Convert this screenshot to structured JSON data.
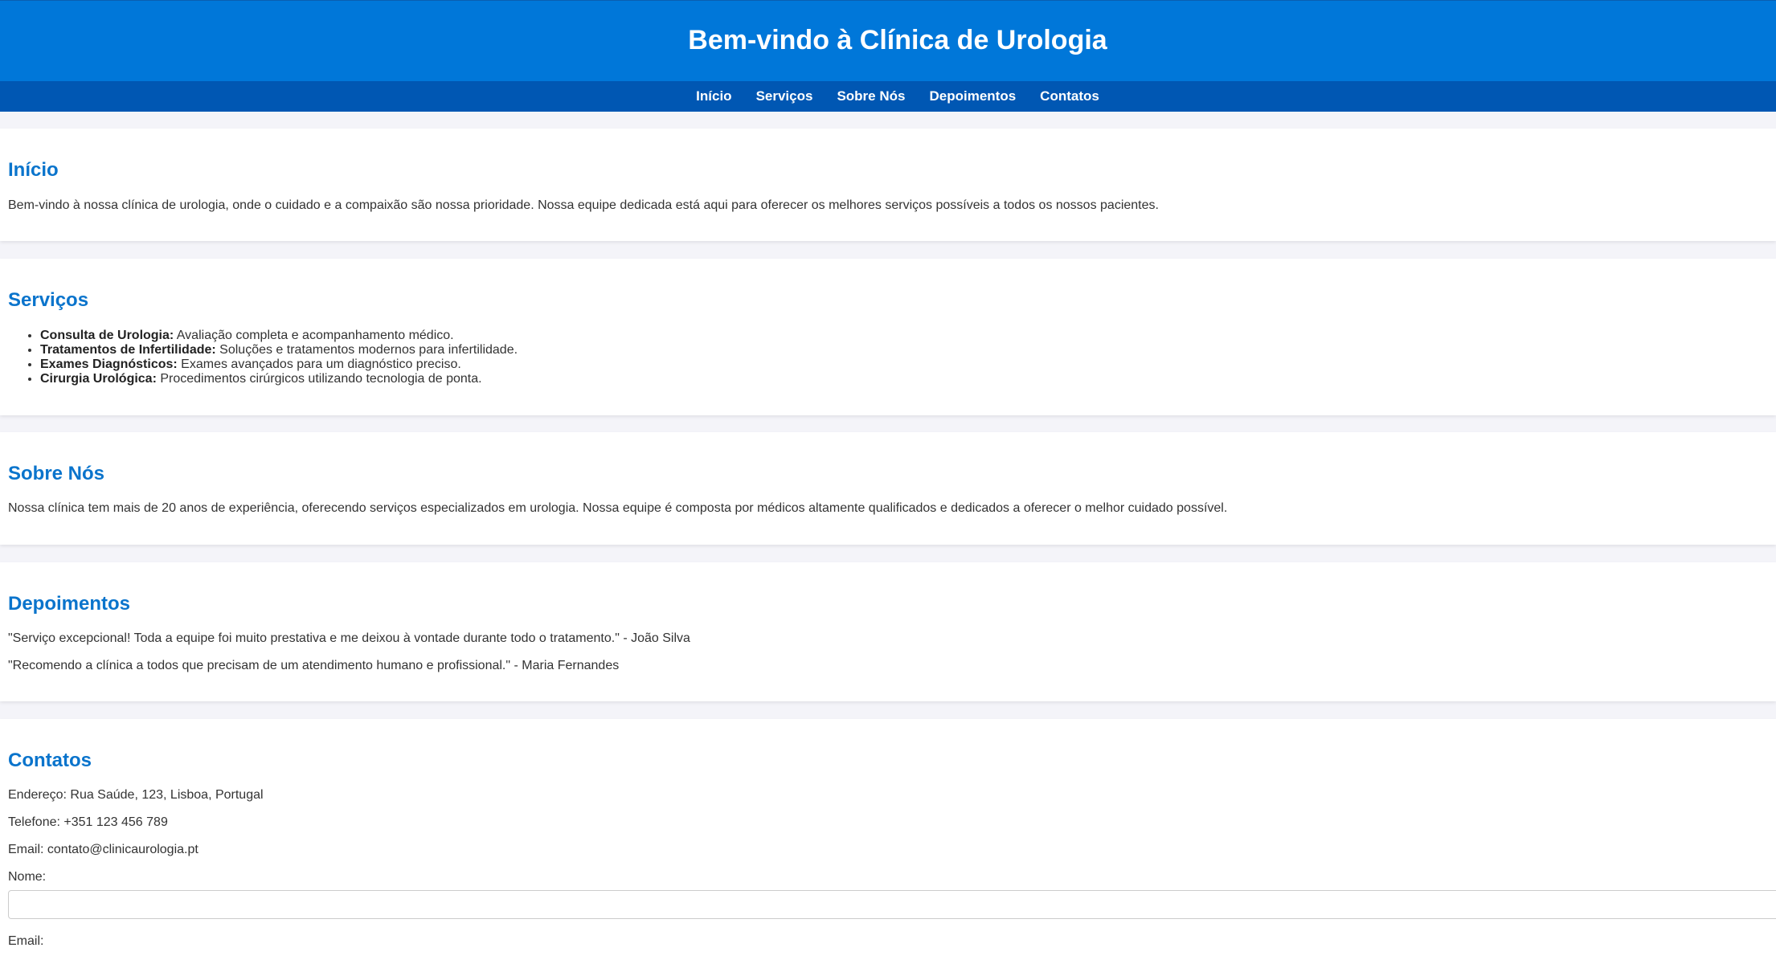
{
  "header": {
    "title": "Bem-vindo à Clínica de Urologia"
  },
  "nav": {
    "items": [
      "Início",
      "Serviços",
      "Sobre Nós",
      "Depoimentos",
      "Contatos"
    ]
  },
  "inicio": {
    "heading": "Início",
    "text": "Bem-vindo à nossa clínica de urologia, onde o cuidado e a compaixão são nossa prioridade. Nossa equipe dedicada está aqui para oferecer os melhores serviços possíveis a todos os nossos pacientes."
  },
  "servicos": {
    "heading": "Serviços",
    "items": [
      {
        "title": "Consulta de Urologia:",
        "desc": " Avaliação completa e acompanhamento médico."
      },
      {
        "title": "Tratamentos de Infertilidade:",
        "desc": " Soluções e tratamentos modernos para infertilidade."
      },
      {
        "title": "Exames Diagnósticos:",
        "desc": " Exames avançados para um diagnóstico preciso."
      },
      {
        "title": "Cirurgia Urológica:",
        "desc": " Procedimentos cirúrgicos utilizando tecnologia de ponta."
      }
    ]
  },
  "sobre": {
    "heading": "Sobre Nós",
    "text": "Nossa clínica tem mais de 20 anos de experiência, oferecendo serviços especializados em urologia. Nossa equipe é composta por médicos altamente qualificados e dedicados a oferecer o melhor cuidado possível."
  },
  "depoimentos": {
    "heading": "Depoimentos",
    "items": [
      "\"Serviço excepcional! Toda a equipe foi muito prestativa e me deixou à vontade durante todo o tratamento.\" - João Silva",
      "\"Recomendo a clínica a todos que precisam de um atendimento humano e profissional.\" - Maria Fernandes"
    ]
  },
  "contatos": {
    "heading": "Contatos",
    "address": "Endereço: Rua Saúde, 123, Lisboa, Portugal",
    "phone": "Telefone: +351 123 456 789",
    "email": "Email: contato@clinicaurologia.pt",
    "form": {
      "name_label": "Nome:",
      "name_value": "",
      "email_label": "Email:"
    }
  }
}
